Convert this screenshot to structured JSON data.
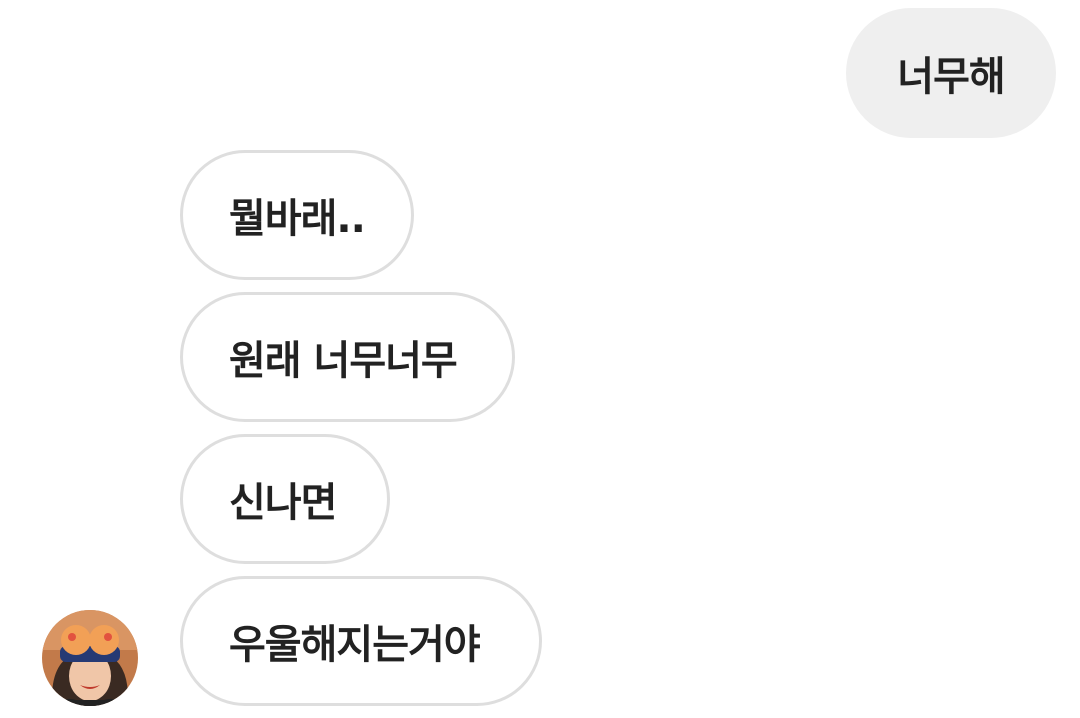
{
  "messages": [
    {
      "direction": "sent",
      "text": "너무해"
    },
    {
      "direction": "received",
      "text": "뭘바래.."
    },
    {
      "direction": "received",
      "text": "원래 너무너무"
    },
    {
      "direction": "received",
      "text": "신나면"
    },
    {
      "direction": "received",
      "text": "우울해지는거야"
    }
  ],
  "sender_avatar": {
    "icon": "profile-photo"
  },
  "colors": {
    "sent_bubble": "#efefef",
    "received_border": "#dedede",
    "text": "#222222",
    "background": "#ffffff"
  }
}
